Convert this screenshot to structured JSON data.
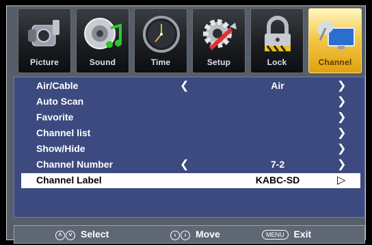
{
  "tabs": [
    {
      "label": "Picture",
      "icon": "camcorder-icon",
      "active": false
    },
    {
      "label": "Sound",
      "icon": "speaker-music-icon",
      "active": false
    },
    {
      "label": "Time",
      "icon": "clock-icon",
      "active": false
    },
    {
      "label": "Setup",
      "icon": "gear-wrench-icon",
      "active": false
    },
    {
      "label": "Lock",
      "icon": "padlock-icon",
      "active": false
    },
    {
      "label": "Channel",
      "icon": "satellite-dish-monitor-icon",
      "active": true
    }
  ],
  "menu": {
    "rows": [
      {
        "name": "Air/Cable",
        "value": "Air",
        "left_arrow": "❮",
        "right_arrow": "❯"
      },
      {
        "name": "Auto Scan",
        "value": "",
        "left_arrow": "",
        "right_arrow": "❯"
      },
      {
        "name": "Favorite",
        "value": "",
        "left_arrow": "",
        "right_arrow": "❯"
      },
      {
        "name": "Channel list",
        "value": "",
        "left_arrow": "",
        "right_arrow": "❯"
      },
      {
        "name": "Show/Hide",
        "value": "",
        "left_arrow": "",
        "right_arrow": "❯"
      },
      {
        "name": "Channel Number",
        "value": "7-2",
        "left_arrow": "❮",
        "right_arrow": "❯"
      },
      {
        "name": "Channel Label",
        "value": "KABC-SD",
        "left_arrow": "",
        "right_arrow": "▷",
        "selected": true
      }
    ]
  },
  "footer": {
    "select_label": "Select",
    "move_label": "Move",
    "menu_key": "MENU",
    "exit_label": "Exit"
  },
  "colors": {
    "accent": "#f4c94a",
    "menu_bg": "#3d4a80",
    "frame_bg": "#565e69"
  }
}
